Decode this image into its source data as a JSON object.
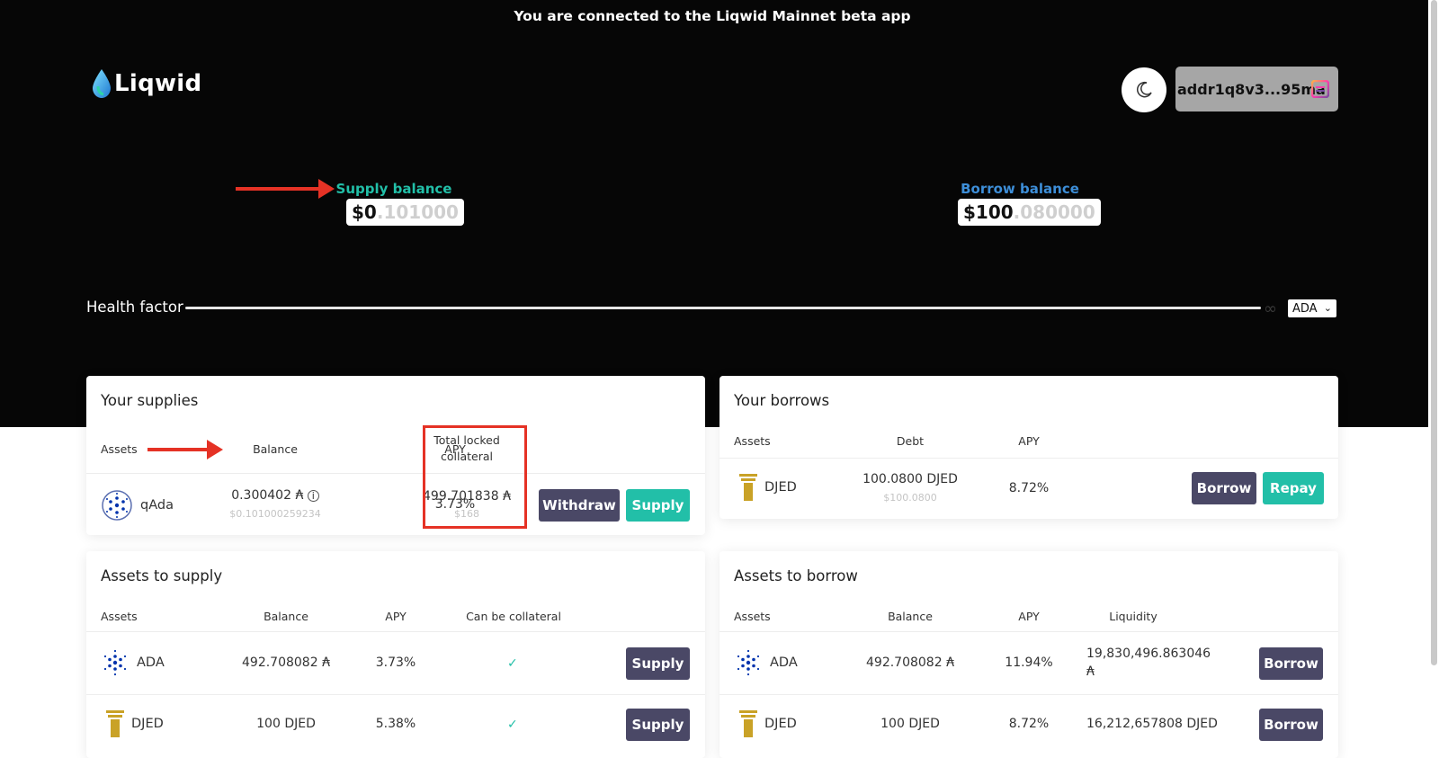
{
  "banner": "You are connected to the Liqwid Mainnet beta app",
  "logo": {
    "text": "Liqwid"
  },
  "header": {
    "address": "addr1q8v3...95ma"
  },
  "supply_balance": {
    "label": "Supply balance",
    "integer": "$0",
    "decimals": ".101000"
  },
  "borrow_balance": {
    "label": "Borrow balance",
    "integer": "$100",
    "decimals": ".080000"
  },
  "health": {
    "label": "Health factor",
    "infinity": "∞",
    "currency": "ADA"
  },
  "your_supplies": {
    "title": "Your supplies",
    "headers": {
      "assets": "Assets",
      "balance": "Balance",
      "apy": "APY",
      "collateral": "Total locked collateral"
    },
    "row": {
      "asset": "qAda",
      "balance": "0.300402 ₳",
      "balance_usd": "$0.101000259234",
      "apy": "3.73%",
      "collateral": "499.701838 ₳",
      "collateral_usd": "$168",
      "withdraw": "Withdraw",
      "supply": "Supply"
    }
  },
  "your_borrows": {
    "title": "Your borrows",
    "headers": {
      "assets": "Assets",
      "debt": "Debt",
      "apy": "APY"
    },
    "row": {
      "asset": "DJED",
      "debt": "100.0800 DJED",
      "debt_usd": "$100.0800",
      "apy": "8.72%",
      "borrow": "Borrow",
      "repay": "Repay"
    }
  },
  "assets_to_supply": {
    "title": "Assets to supply",
    "headers": {
      "assets": "Assets",
      "balance": "Balance",
      "apy": "APY",
      "collateral": "Can be collateral"
    },
    "rows": [
      {
        "asset": "ADA",
        "balance": "492.708082 ₳",
        "apy": "3.73%",
        "collateral": "✓",
        "action": "Supply"
      },
      {
        "asset": "DJED",
        "balance": "100 DJED",
        "apy": "5.38%",
        "collateral": "✓",
        "action": "Supply"
      }
    ]
  },
  "assets_to_borrow": {
    "title": "Assets to borrow",
    "headers": {
      "assets": "Assets",
      "balance": "Balance",
      "apy": "APY",
      "liquidity": "Liquidity"
    },
    "rows": [
      {
        "asset": "ADA",
        "balance": "492.708082 ₳",
        "apy": "11.94%",
        "liquidity": "19,830,496.863046",
        "liquidity_unit": "₳",
        "action": "Borrow"
      },
      {
        "asset": "DJED",
        "balance": "100 DJED",
        "apy": "8.72%",
        "liquidity": "16,212,657808 DJED",
        "action": "Borrow"
      }
    ]
  },
  "colors": {
    "teal": "#22bfa8",
    "blue": "#3d8ed8",
    "dark_button": "#4a4866",
    "annotation_red": "#e53225"
  }
}
